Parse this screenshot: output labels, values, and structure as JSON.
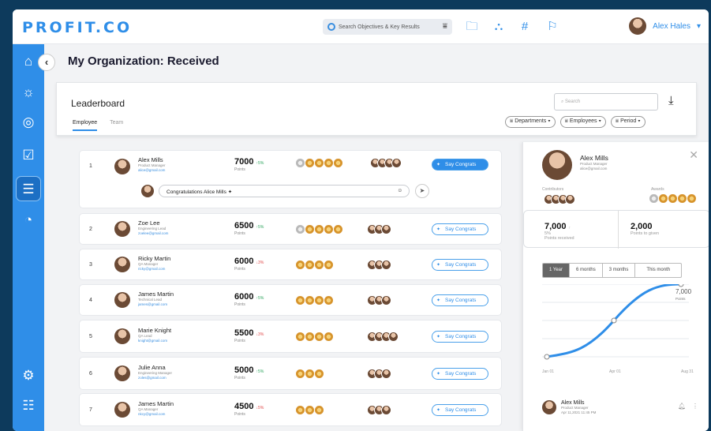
{
  "brand": {
    "logo": "PROFIT.CO",
    "accent": "#2f8ee8"
  },
  "search": {
    "placeholder": "Search Objectives & Key Results"
  },
  "user": {
    "name": "Alex Hales"
  },
  "page": {
    "title": "My Organization: Received"
  },
  "leaderboard": {
    "title": "Leaderboard",
    "tabs": [
      "Employee",
      "Team"
    ],
    "search_placeholder": "Search",
    "filters": [
      "Departments",
      "Employees",
      "Period"
    ],
    "points_label": "Points",
    "congrats_label": "Say Congrats",
    "comment_text": "Congratulations Alice Mills",
    "rows": [
      {
        "rank": "1",
        "name": "Alex Mills",
        "role": "Product Manager",
        "email": "alice@gmail.com",
        "points": "7000",
        "delta": "5%",
        "trend": "up",
        "medals": 5
      },
      {
        "rank": "2",
        "name": "Zoe Lee",
        "role": "Engineering Lead",
        "email": "zoelee@gmail.com",
        "points": "6500",
        "delta": "5%",
        "trend": "up",
        "medals": 5
      },
      {
        "rank": "3",
        "name": "Ricky Martin",
        "role": "QA Manager",
        "email": "ricky@gmail.com",
        "points": "6000",
        "delta": "3%",
        "trend": "down",
        "medals": 4
      },
      {
        "rank": "4",
        "name": "James Martin",
        "role": "Technical Lead",
        "email": "james@gmail.com",
        "points": "6000",
        "delta": "5%",
        "trend": "up",
        "medals": 4
      },
      {
        "rank": "5",
        "name": "Marie Knight",
        "role": "QA Lead",
        "email": "knight@gmail.com",
        "points": "5500",
        "delta": "3%",
        "trend": "down",
        "medals": 4
      },
      {
        "rank": "6",
        "name": "Julie Anna",
        "role": "Engineering Manager",
        "email": "zoles@gmail.com",
        "points": "5000",
        "delta": "5%",
        "trend": "up",
        "medals": 3
      },
      {
        "rank": "7",
        "name": "James Martin",
        "role": "QA Manager",
        "email": "nkcy@gmail.com",
        "points": "4500",
        "delta": "5%",
        "trend": "down",
        "medals": 3
      }
    ]
  },
  "panel": {
    "name": "Alex Mills",
    "role": "Product Manager",
    "email": "alice@gmail.com",
    "contributors_label": "Contributors",
    "awards_label": "Awards",
    "received": "7,000",
    "received_delta": "5%",
    "received_label": "Points received",
    "given": "2,000",
    "given_label": "Points to given",
    "ranges": [
      "1 Year",
      "6 months",
      "3 months",
      "This month"
    ],
    "chart_end_value": "7,000",
    "chart_end_label": "Points",
    "x_ticks": [
      "Jan 01",
      "Apr 01",
      "Aug 31"
    ],
    "activity": {
      "name": "Alex Mills",
      "role": "Product Manager",
      "date": "Apr 11,2021 11:45 PM"
    }
  },
  "chart_data": {
    "type": "line",
    "x": [
      "Jan 01",
      "Apr 01",
      "Aug 31"
    ],
    "series": [
      {
        "values": [
          0,
          3500,
          7000
        ]
      }
    ],
    "annotations": [
      "7,000 Points"
    ]
  }
}
